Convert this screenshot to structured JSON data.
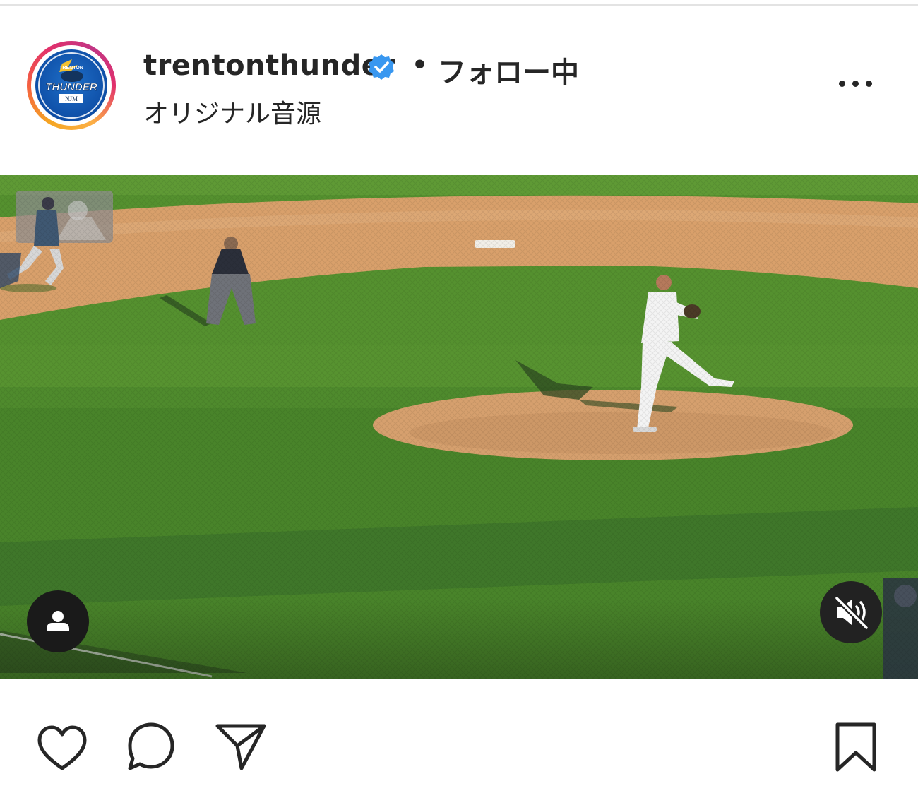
{
  "post": {
    "username": "trentonthunder",
    "separator": "•",
    "follow_status": "フォロー中",
    "audio_label": "オリジナル音源",
    "verified": true
  },
  "avatar": {
    "logo_text_top": "TRENTON",
    "logo_text_main": "THUNDER",
    "logo_text_sub": "NJM"
  },
  "video": {
    "muted": true,
    "has_tagged_users": true
  },
  "actions": {
    "like_icon": "heart-icon",
    "comment_icon": "comment-bubble-icon",
    "share_icon": "paper-plane-icon",
    "save_icon": "bookmark-icon"
  },
  "colors": {
    "verified_badge": "#3897f0",
    "text": "#262626",
    "grass": "#4f8a2e",
    "infield_dirt": "#d7a06a"
  }
}
